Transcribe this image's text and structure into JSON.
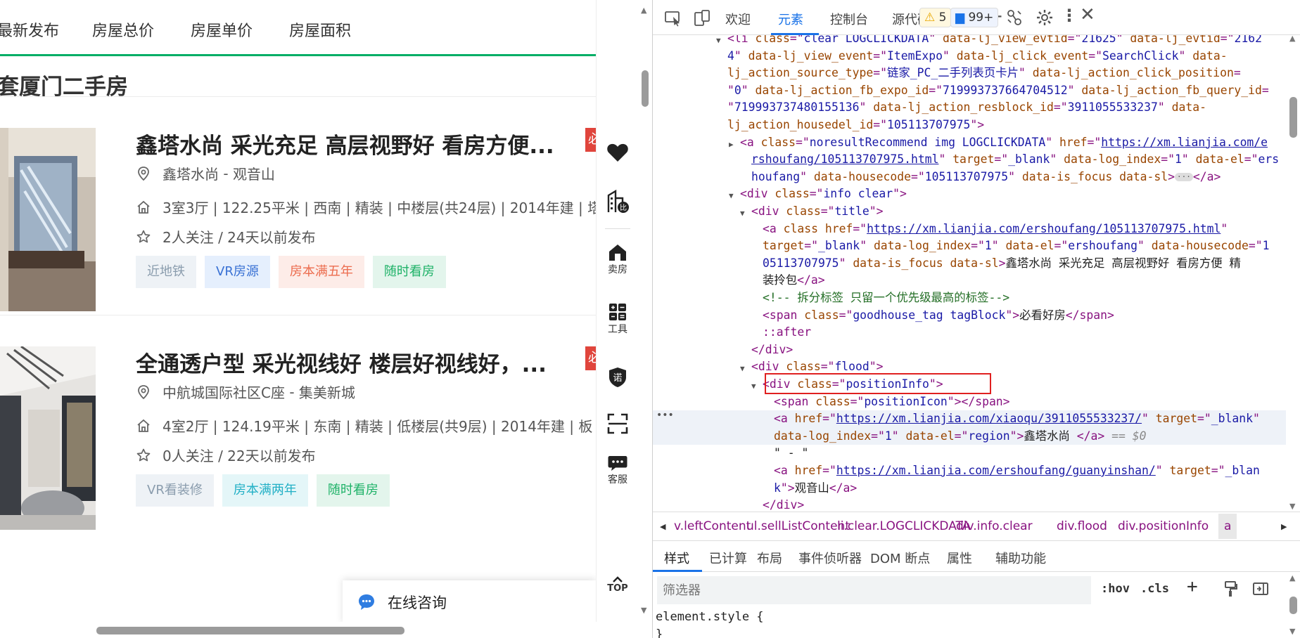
{
  "sort_tabs": [
    "最新发布",
    "房屋总价",
    "房屋单价",
    "房屋面积"
  ],
  "result_title": "套厦门二手房",
  "houses": [
    {
      "title": "鑫塔水尚 采光充足 高层视野好 看房方便...",
      "tag_label": "必",
      "community": "鑫塔水尚",
      "separator": " - ",
      "region": "观音山",
      "house_info": "3室3厅 | 122.25平米 | 西南 | 精装 | 中楼层(共24层) | 2014年建 | 塔",
      "follow_info": "2人关注 / 24天以前发布",
      "tags": [
        {
          "text": "近地铁",
          "bg": "#eef2f6",
          "color": "#8a9cad"
        },
        {
          "text": "VR房源",
          "bg": "#e5effd",
          "color": "#3971d4"
        },
        {
          "text": "房本满五年",
          "bg": "#fdece8",
          "color": "#ec6c4e"
        },
        {
          "text": "随时看房",
          "bg": "#e3f5ec",
          "color": "#1fb268"
        }
      ]
    },
    {
      "title": "全通透户型 采光视线好 楼层好视线好，...",
      "tag_label": "必",
      "community": "中航城国际社区C座",
      "separator": " - ",
      "region": "集美新城",
      "house_info": "4室2厅 | 124.19平米 | 东南 | 精装 | 低楼层(共9层) | 2014年建 | 板",
      "follow_info": "0人关注 / 22天以前发布",
      "tags": [
        {
          "text": "VR看装修",
          "bg": "#eef2f6",
          "color": "#8a9cad"
        },
        {
          "text": "房本满两年",
          "bg": "#e4f6f8",
          "color": "#22b0c6"
        },
        {
          "text": "随时看房",
          "bg": "#e3f5ec",
          "color": "#1fb268"
        }
      ]
    }
  ],
  "float_bar": {
    "sell_label": "卖房",
    "tools_label": "工具",
    "service_label": "客服",
    "top_label": "TOP"
  },
  "consult_label": "在线咨询",
  "devtools": {
    "tabs": [
      "欢迎",
      "元素",
      "控制台",
      "源代码"
    ],
    "active_tab": "元素",
    "warnings_count": "5",
    "messages_count": "99+",
    "dom_lines": [
      [
        [
          "tg",
          "<li "
        ],
        [
          "an",
          "class"
        ],
        [
          "tg",
          "=\""
        ],
        [
          "av",
          "clear LOGCLICKDATA"
        ],
        [
          "tg",
          "\" "
        ],
        [
          "an",
          "data-lj_view_evtid"
        ],
        [
          "tg",
          "=\""
        ],
        [
          "av",
          "21625"
        ],
        [
          "tg",
          "\" "
        ],
        [
          "an",
          "data-lj_evtid"
        ],
        [
          "tg",
          "=\""
        ],
        [
          "av",
          "2162"
        ]
      ],
      [
        [
          "av",
          "4"
        ],
        [
          "tg",
          "\" "
        ],
        [
          "an",
          "data-lj_view_event"
        ],
        [
          "tg",
          "=\""
        ],
        [
          "av",
          "ItemExpo"
        ],
        [
          "tg",
          "\" "
        ],
        [
          "an",
          "data-lj_click_event"
        ],
        [
          "tg",
          "=\""
        ],
        [
          "av",
          "SearchClick"
        ],
        [
          "tg",
          "\" "
        ],
        [
          "an",
          "data-"
        ]
      ],
      [
        [
          "an",
          "lj_action_source_type"
        ],
        [
          "tg",
          "=\""
        ],
        [
          "av",
          "链家_PC_二手列表页卡片"
        ],
        [
          "tg",
          "\" "
        ],
        [
          "an",
          "data-lj_action_click_position"
        ],
        [
          "tg",
          "="
        ]
      ],
      [
        [
          "tg",
          "\""
        ],
        [
          "av",
          "0"
        ],
        [
          "tg",
          "\" "
        ],
        [
          "an",
          "data-lj_action_fb_expo_id"
        ],
        [
          "tg",
          "=\""
        ],
        [
          "av",
          "719993737664704512"
        ],
        [
          "tg",
          "\" "
        ],
        [
          "an",
          "data-lj_action_fb_query_id"
        ],
        [
          "tg",
          "="
        ]
      ],
      [
        [
          "tg",
          "\""
        ],
        [
          "av",
          "719993737480155136"
        ],
        [
          "tg",
          "\" "
        ],
        [
          "an",
          "data-lj_action_resblock_id"
        ],
        [
          "tg",
          "=\""
        ],
        [
          "av",
          "3911055533237"
        ],
        [
          "tg",
          "\" "
        ],
        [
          "an",
          "data-"
        ]
      ],
      [
        [
          "an",
          "lj_action_housedel_id"
        ],
        [
          "tg",
          "=\""
        ],
        [
          "av",
          "105113707975"
        ],
        [
          "tg",
          "\">"
        ]
      ],
      [
        [
          "tg",
          "<a "
        ],
        [
          "an",
          "class"
        ],
        [
          "tg",
          "=\""
        ],
        [
          "av",
          "noresultRecommend img LOGCLICKDATA"
        ],
        [
          "tg",
          "\" "
        ],
        [
          "an",
          "href"
        ],
        [
          "tg",
          "=\""
        ],
        [
          "lk",
          "https://xm.lianjia.com/e"
        ]
      ],
      [
        [
          "lk",
          "rshoufang/105113707975.html"
        ],
        [
          "tg",
          "\" "
        ],
        [
          "an",
          "target"
        ],
        [
          "tg",
          "=\""
        ],
        [
          "av",
          "_blank"
        ],
        [
          "tg",
          "\" "
        ],
        [
          "an",
          "data-log_index"
        ],
        [
          "tg",
          "=\""
        ],
        [
          "av",
          "1"
        ],
        [
          "tg",
          "\" "
        ],
        [
          "an",
          "data-el"
        ],
        [
          "tg",
          "=\""
        ],
        [
          "av",
          "ers"
        ]
      ],
      [
        [
          "av",
          "houfang"
        ],
        [
          "tg",
          "\" "
        ],
        [
          "an",
          "data-housecode"
        ],
        [
          "tg",
          "=\""
        ],
        [
          "av",
          "105113707975"
        ],
        [
          "tg",
          "\" "
        ],
        [
          "an",
          "data-is_focus"
        ],
        [
          "tg",
          " "
        ],
        [
          "an",
          "data-sl"
        ],
        [
          "tg",
          ">"
        ],
        [
          "el",
          "···"
        ],
        [
          "tg",
          "</a>"
        ]
      ],
      [
        [
          "tg",
          "<div "
        ],
        [
          "an",
          "class"
        ],
        [
          "tg",
          "=\""
        ],
        [
          "av",
          "info clear"
        ],
        [
          "tg",
          "\">"
        ]
      ],
      [
        [
          "tg",
          "<div "
        ],
        [
          "an",
          "class"
        ],
        [
          "tg",
          "=\""
        ],
        [
          "av",
          "title"
        ],
        [
          "tg",
          "\">"
        ]
      ],
      [
        [
          "tg",
          "<a "
        ],
        [
          "an",
          "class"
        ],
        [
          "tg",
          " "
        ],
        [
          "an",
          "href"
        ],
        [
          "tg",
          "=\""
        ],
        [
          "lk",
          "https://xm.lianjia.com/ershoufang/105113707975.html"
        ],
        [
          "tg",
          "\""
        ]
      ],
      [
        [
          "an",
          "target"
        ],
        [
          "tg",
          "=\""
        ],
        [
          "av",
          "_blank"
        ],
        [
          "tg",
          "\" "
        ],
        [
          "an",
          "data-log_index"
        ],
        [
          "tg",
          "=\""
        ],
        [
          "av",
          "1"
        ],
        [
          "tg",
          "\" "
        ],
        [
          "an",
          "data-el"
        ],
        [
          "tg",
          "=\""
        ],
        [
          "av",
          "ershoufang"
        ],
        [
          "tg",
          "\" "
        ],
        [
          "an",
          "data-housecode"
        ],
        [
          "tg",
          "=\""
        ],
        [
          "av",
          "1"
        ]
      ],
      [
        [
          "av",
          "05113707975"
        ],
        [
          "tg",
          "\" "
        ],
        [
          "an",
          "data-is_focus"
        ],
        [
          "tg",
          " "
        ],
        [
          "an",
          "data-sl"
        ],
        [
          "tg",
          ">"
        ],
        [
          "tx",
          "鑫塔水尚 采光充足 高层视野好 看房方便 精"
        ]
      ],
      [
        [
          "tx",
          "装拎包"
        ],
        [
          "tg",
          "</a>"
        ]
      ],
      [
        [
          "cm",
          "<!-- 拆分标签 只留一个优先级最高的标签-->"
        ]
      ],
      [
        [
          "tg",
          "<span "
        ],
        [
          "an",
          "class"
        ],
        [
          "tg",
          "=\""
        ],
        [
          "av",
          "goodhouse_tag tagBlock"
        ],
        [
          "tg",
          "\">"
        ],
        [
          "tx",
          "必看好房"
        ],
        [
          "tg",
          "</span>"
        ]
      ],
      [
        [
          "pe",
          "::after"
        ]
      ],
      [
        [
          "tg",
          "</div>"
        ]
      ],
      [
        [
          "tg",
          "<div "
        ],
        [
          "an",
          "class"
        ],
        [
          "tg",
          "=\""
        ],
        [
          "av",
          "flood"
        ],
        [
          "tg",
          "\">"
        ]
      ],
      [
        [
          "tg",
          "<div "
        ],
        [
          "an",
          "class"
        ],
        [
          "tg",
          "=\""
        ],
        [
          "av",
          "positionInfo"
        ],
        [
          "tg",
          "\">"
        ]
      ],
      [
        [
          "tg",
          "<span "
        ],
        [
          "an",
          "class"
        ],
        [
          "tg",
          "=\""
        ],
        [
          "av",
          "positionIcon"
        ],
        [
          "tg",
          "\"></span>"
        ]
      ],
      [
        [
          "tg",
          "<a "
        ],
        [
          "an",
          "href"
        ],
        [
          "tg",
          "=\""
        ],
        [
          "lk",
          "https://xm.lianjia.com/xiaoqu/3911055533237/"
        ],
        [
          "tg",
          "\" "
        ],
        [
          "an",
          "target"
        ],
        [
          "tg",
          "=\""
        ],
        [
          "av",
          "_blank"
        ],
        [
          "tg",
          "\""
        ]
      ],
      [
        [
          "an",
          "data-log_index"
        ],
        [
          "tg",
          "=\""
        ],
        [
          "av",
          "1"
        ],
        [
          "tg",
          "\" "
        ],
        [
          "an",
          "data-el"
        ],
        [
          "tg",
          "=\""
        ],
        [
          "av",
          "region"
        ],
        [
          "tg",
          "\">"
        ],
        [
          "tx",
          "鑫塔水尚 "
        ],
        [
          "tg",
          "</a>"
        ],
        [
          "eq",
          " == $0"
        ]
      ],
      [
        [
          "tx",
          "\" - \""
        ]
      ],
      [
        [
          "tg",
          "<a "
        ],
        [
          "an",
          "href"
        ],
        [
          "tg",
          "=\""
        ],
        [
          "lk",
          "https://xm.lianjia.com/ershoufang/guanyinshan/"
        ],
        [
          "tg",
          "\" "
        ],
        [
          "an",
          "target"
        ],
        [
          "tg",
          "=\""
        ],
        [
          "av",
          "_blan"
        ]
      ],
      [
        [
          "av",
          "k"
        ],
        [
          "tg",
          "\">"
        ],
        [
          "tx",
          "观音山"
        ],
        [
          "tg",
          "</a>"
        ]
      ],
      [
        [
          "tg",
          "</div>"
        ]
      ]
    ],
    "breadcrumbs": [
      "v.leftContent",
      "ul.sellListContent",
      "li.clear.LOGCLICKDATA",
      "div.info.clear",
      "div.flood",
      "div.positionInfo",
      "a"
    ],
    "sub_tabs": [
      "样式",
      "已计算",
      "布局",
      "事件侦听器",
      "DOM 断点",
      "属性",
      "辅助功能"
    ],
    "filter_placeholder": "筛选器",
    "hov_label": ":hov",
    "cls_label": ".cls",
    "styles_text": "element.style {"
  }
}
